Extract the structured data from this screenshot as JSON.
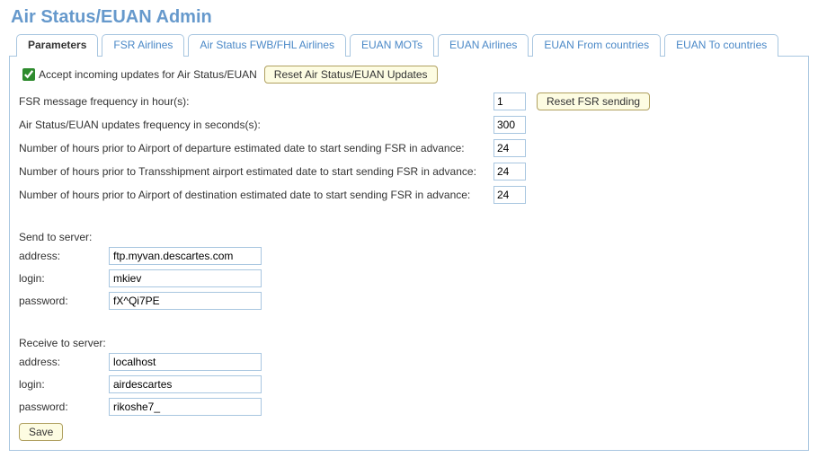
{
  "title": "Air Status/EUAN Admin",
  "tabs": [
    {
      "label": "Parameters",
      "active": true
    },
    {
      "label": "FSR Airlines",
      "active": false
    },
    {
      "label": "Air Status FWB/FHL Airlines",
      "active": false
    },
    {
      "label": "EUAN MOTs",
      "active": false
    },
    {
      "label": "EUAN Airlines",
      "active": false
    },
    {
      "label": "EUAN From countries",
      "active": false
    },
    {
      "label": "EUAN To countries",
      "active": false
    }
  ],
  "accept_checkbox": {
    "label": "Accept incoming updates for Air Status/EUAN",
    "checked": true
  },
  "buttons": {
    "reset_updates": "Reset Air Status/EUAN Updates",
    "reset_fsr": "Reset FSR sending",
    "save": "Save"
  },
  "params": {
    "fsr_freq": {
      "label": "FSR message frequency in hour(s):",
      "value": "1"
    },
    "euan_update": {
      "label": "Air Status/EUAN updates frequency in seconds(s):",
      "value": "300"
    },
    "hours_dep": {
      "label": "Number of hours prior to Airport of departure estimated date to start sending FSR in advance:",
      "value": "24"
    },
    "hours_trans": {
      "label": "Number of hours prior to Transshipment airport estimated date to start sending FSR in advance:",
      "value": "24"
    },
    "hours_dest": {
      "label": "Number of hours prior to Airport of destination estimated date to start sending FSR in advance:",
      "value": "24"
    }
  },
  "send_server": {
    "title": "Send to server:",
    "address_label": "address:",
    "login_label": "login:",
    "password_label": "password:",
    "address": "ftp.myvan.descartes.com",
    "login": "mkiev",
    "password": "fX^Qi7PE"
  },
  "receive_server": {
    "title": "Receive to server:",
    "address_label": "address:",
    "login_label": "login:",
    "password_label": "password:",
    "address": "localhost",
    "login": "airdescartes",
    "password": "rikoshe7_"
  }
}
